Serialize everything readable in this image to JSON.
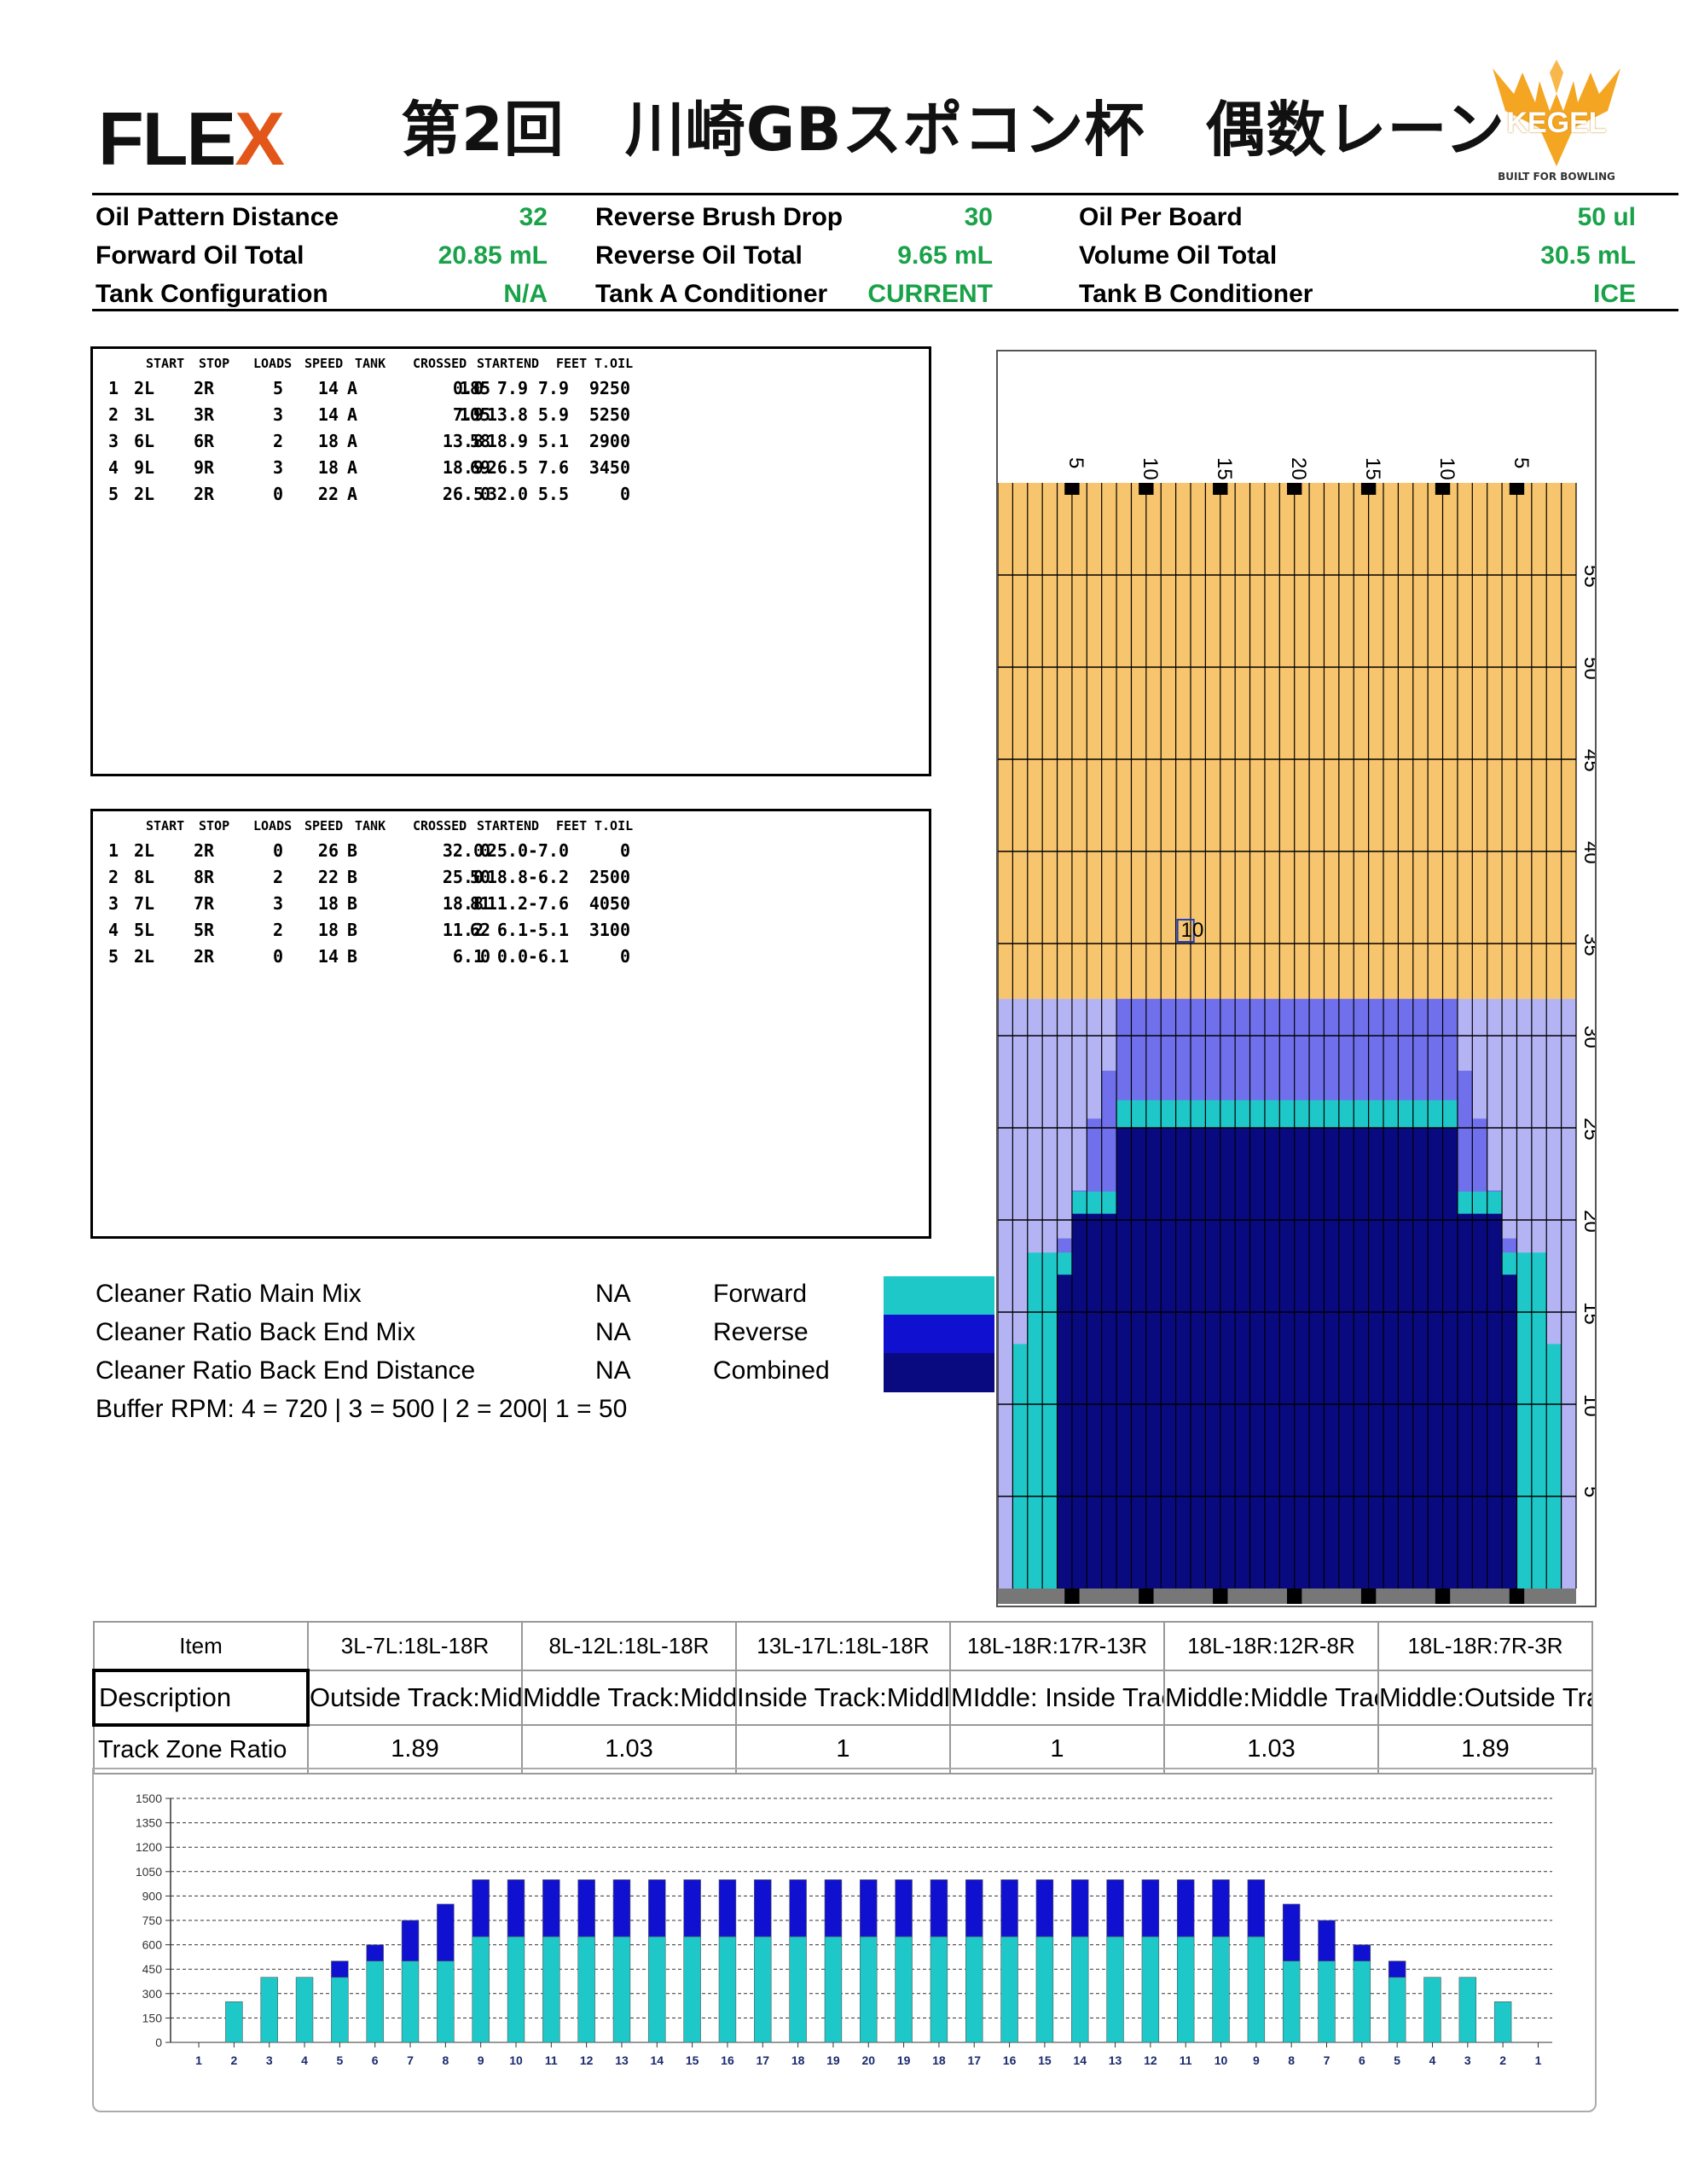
{
  "header": {
    "logo_text": "FLE",
    "logo_x": "X",
    "title": "第2回　川崎GBスポコン杯　偶数レーン",
    "kegel_name": "KEGEL",
    "kegel_tagline": "BUILT FOR BOWLING"
  },
  "info": {
    "col1": [
      {
        "label": "Oil Pattern Distance",
        "value": "32"
      },
      {
        "label": "Forward Oil Total",
        "value": "20.85 mL"
      },
      {
        "label": "Tank Configuration",
        "value": "N/A"
      }
    ],
    "col2": [
      {
        "label": "Reverse Brush Drop",
        "value": "30"
      },
      {
        "label": "Reverse Oil Total",
        "value": "9.65 mL"
      },
      {
        "label": "Tank A Conditioner",
        "value": "CURRENT"
      }
    ],
    "col3": [
      {
        "label": "Oil Per Board",
        "value": "50 ul"
      },
      {
        "label": "Volume Oil Total",
        "value": "30.5 mL"
      },
      {
        "label": "Tank B Conditioner",
        "value": "ICE"
      }
    ]
  },
  "table_headers": [
    "START",
    "STOP",
    "LOADS",
    "SPEED",
    "TANK",
    "CROSSED",
    "START",
    "END",
    "FEET",
    "T.OIL"
  ],
  "forward_table": [
    [
      "1",
      "2L",
      "2R",
      "5",
      "14",
      "A",
      "185",
      "0.0",
      "7.9",
      "7.9",
      "9250"
    ],
    [
      "2",
      "3L",
      "3R",
      "3",
      "14",
      "A",
      "105",
      "7.9",
      "13.8",
      "5.9",
      "5250"
    ],
    [
      "3",
      "6L",
      "6R",
      "2",
      "18",
      "A",
      "58",
      "13.8",
      "18.9",
      "5.1",
      "2900"
    ],
    [
      "4",
      "9L",
      "9R",
      "3",
      "18",
      "A",
      "69",
      "18.9",
      "26.5",
      "7.6",
      "3450"
    ],
    [
      "5",
      "2L",
      "2R",
      "0",
      "22",
      "A",
      "0",
      "26.5",
      "32.0",
      "5.5",
      "0"
    ]
  ],
  "reverse_table": [
    [
      "1",
      "2L",
      "2R",
      "0",
      "26",
      "B",
      "0",
      "32.0",
      "25.0",
      "-7.0",
      "0"
    ],
    [
      "2",
      "8L",
      "8R",
      "2",
      "22",
      "B",
      "50",
      "25.0",
      "18.8",
      "-6.2",
      "2500"
    ],
    [
      "3",
      "7L",
      "7R",
      "3",
      "18",
      "B",
      "81",
      "18.8",
      "11.2",
      "-7.6",
      "4050"
    ],
    [
      "4",
      "5L",
      "5R",
      "2",
      "18",
      "B",
      "62",
      "11.2",
      "6.1",
      "-5.1",
      "3100"
    ],
    [
      "5",
      "2L",
      "2R",
      "0",
      "14",
      "B",
      "0",
      "6.1",
      "0.0",
      "-6.1",
      "0"
    ]
  ],
  "notes": [
    {
      "label": "Cleaner Ratio Main Mix",
      "value": "NA"
    },
    {
      "label": "Cleaner Ratio Back End Mix",
      "value": "NA"
    },
    {
      "label": "Cleaner Ratio Back End Distance",
      "value": "NA"
    }
  ],
  "buffer_rpm": "Buffer RPM: 4 = 720  |  3 = 500  |  2 = 200|  1 = 50",
  "legend": [
    {
      "label": "Forward",
      "color": "#1ec8c8"
    },
    {
      "label": "Reverse",
      "color": "#1010d0"
    },
    {
      "label": "Combined",
      "color": "#0a0a80"
    }
  ],
  "colors": {
    "lane_dry": "#f7c56e",
    "lane_buffed": "#b4b4f4",
    "lane_reverse_light": "#7070ec",
    "forward": "#1ec8c8",
    "reverse": "#1010d0",
    "combined": "#0a0a80",
    "info_value": "#1aa24a"
  },
  "lane_chart": {
    "board_labels_top": [
      "5",
      "10",
      "15",
      "20",
      "15",
      "10",
      "5"
    ],
    "distance_labels": [
      "5",
      "10",
      "15",
      "20",
      "25",
      "30",
      "35",
      "40",
      "45",
      "50",
      "55"
    ],
    "board_marker": "10",
    "oil_pattern_distance_ft": 32,
    "lane_length_ft": 60
  },
  "track_zone": {
    "header": [
      "Item",
      "3L-7L:18L-18R",
      "8L-12L:18L-18R",
      "13L-17L:18L-18R",
      "18L-18R:17R-13R",
      "18L-18R:12R-8R",
      "18L-18R:7R-3R"
    ],
    "description_label": "Description",
    "descriptions": [
      "Outside Track:Middle",
      "Middle Track:Middle",
      "Inside Track:Middle",
      "MIddle: Inside Track",
      "Middle:Middle Track",
      "Middle:Outside Track"
    ],
    "ratio_label": "Track Zone Ratio",
    "ratios": [
      "1.89",
      "1.03",
      "1",
      "1",
      "1.03",
      "1.89"
    ]
  },
  "chart_data": {
    "type": "bar",
    "stacked": true,
    "categories": [
      "1",
      "2",
      "3",
      "4",
      "5",
      "6",
      "7",
      "8",
      "9",
      "10",
      "11",
      "12",
      "13",
      "14",
      "15",
      "16",
      "17",
      "18",
      "19",
      "20",
      "19",
      "18",
      "17",
      "16",
      "15",
      "14",
      "13",
      "12",
      "11",
      "10",
      "9",
      "8",
      "7",
      "6",
      "5",
      "4",
      "3",
      "2",
      "1"
    ],
    "series": [
      {
        "name": "Forward",
        "values": [
          0,
          250,
          400,
          400,
          400,
          500,
          500,
          500,
          650,
          650,
          650,
          650,
          650,
          650,
          650,
          650,
          650,
          650,
          650,
          650,
          650,
          650,
          650,
          650,
          650,
          650,
          650,
          650,
          650,
          650,
          650,
          500,
          500,
          500,
          400,
          400,
          400,
          250,
          0
        ]
      },
      {
        "name": "Reverse",
        "values": [
          0,
          0,
          0,
          0,
          100,
          100,
          250,
          350,
          350,
          350,
          350,
          350,
          350,
          350,
          350,
          350,
          350,
          350,
          350,
          350,
          350,
          350,
          350,
          350,
          350,
          350,
          350,
          350,
          350,
          350,
          350,
          350,
          250,
          100,
          100,
          0,
          0,
          0,
          0
        ]
      }
    ],
    "yticks": [
      "0",
      "150",
      "300",
      "450",
      "600",
      "750",
      "900",
      "1050",
      "1200",
      "1350",
      "1500"
    ],
    "ylim": [
      0,
      1500
    ],
    "grid": true
  }
}
